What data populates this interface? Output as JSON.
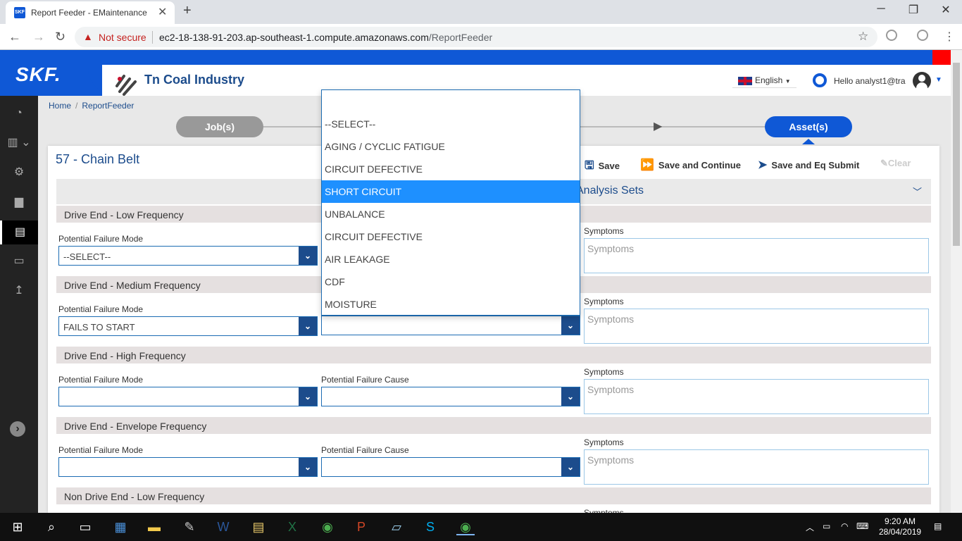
{
  "browser": {
    "tab_title": "Report Feeder - EMaintenance",
    "favicon_text": "SKF",
    "new_tab": "+",
    "security_label": "Not secure",
    "url_host": "ec2-18-138-91-203.ap-southeast-1.compute.amazonaws.com",
    "url_path": "/ReportFeeder",
    "window_controls": [
      "─",
      "❐",
      "✕"
    ],
    "nav": {
      "back": "←",
      "forward": "→",
      "reload": "↻"
    },
    "bookmark_icon": "☆"
  },
  "app": {
    "logo": "SKF.",
    "company": "Tn Coal Industry",
    "language": "English",
    "language_caret": "▼",
    "greeting": "Hello analyst1@tra",
    "user_caret": "▼"
  },
  "breadcrumb": [
    "Home",
    "ReportFeeder"
  ],
  "steps": {
    "jobs": "Job(s)",
    "assets": "Asset(s)"
  },
  "asset_title": "57 - Chain Belt",
  "toolbar": {
    "save": "Save",
    "save_continue": "Save and Continue",
    "save_submit": "Save and Eq Submit",
    "clear": "Clear"
  },
  "analysis_sets_title": "Analysis Sets",
  "labels": {
    "mode": "Potential Failure Mode",
    "cause": "Potential Failure Cause",
    "symptoms": "Symptoms",
    "symptoms_placeholder": "Symptoms"
  },
  "sections": [
    {
      "title": "Drive End - Low Frequency",
      "mode": "--SELECT--",
      "cause": ""
    },
    {
      "title": "Drive End - Medium Frequency",
      "mode": "FAILS TO START",
      "cause": ""
    },
    {
      "title": "Drive End - High Frequency",
      "mode": "",
      "cause": ""
    },
    {
      "title": "Drive End - Envelope Frequency",
      "mode": "",
      "cause": ""
    },
    {
      "title": "Non Drive End - Low Frequency",
      "mode": "",
      "cause": ""
    }
  ],
  "dropdown": {
    "options": [
      "--SELECT--",
      "AGING / CYCLIC FATIGUE",
      "CIRCUIT DEFECTIVE",
      "SHORT CIRCUIT",
      "UNBALANCE",
      "CIRCUIT DEFECTIVE",
      "AIR LEAKAGE",
      "CDF",
      "MOISTURE"
    ],
    "highlighted": "SHORT CIRCUIT"
  },
  "taskbar": {
    "time": "9:20 AM",
    "date": "28/04/2019"
  },
  "colors": {
    "brand_blue": "#0f58d6",
    "highlight": "#1e90ff",
    "title_blue": "#1c4c8c"
  }
}
